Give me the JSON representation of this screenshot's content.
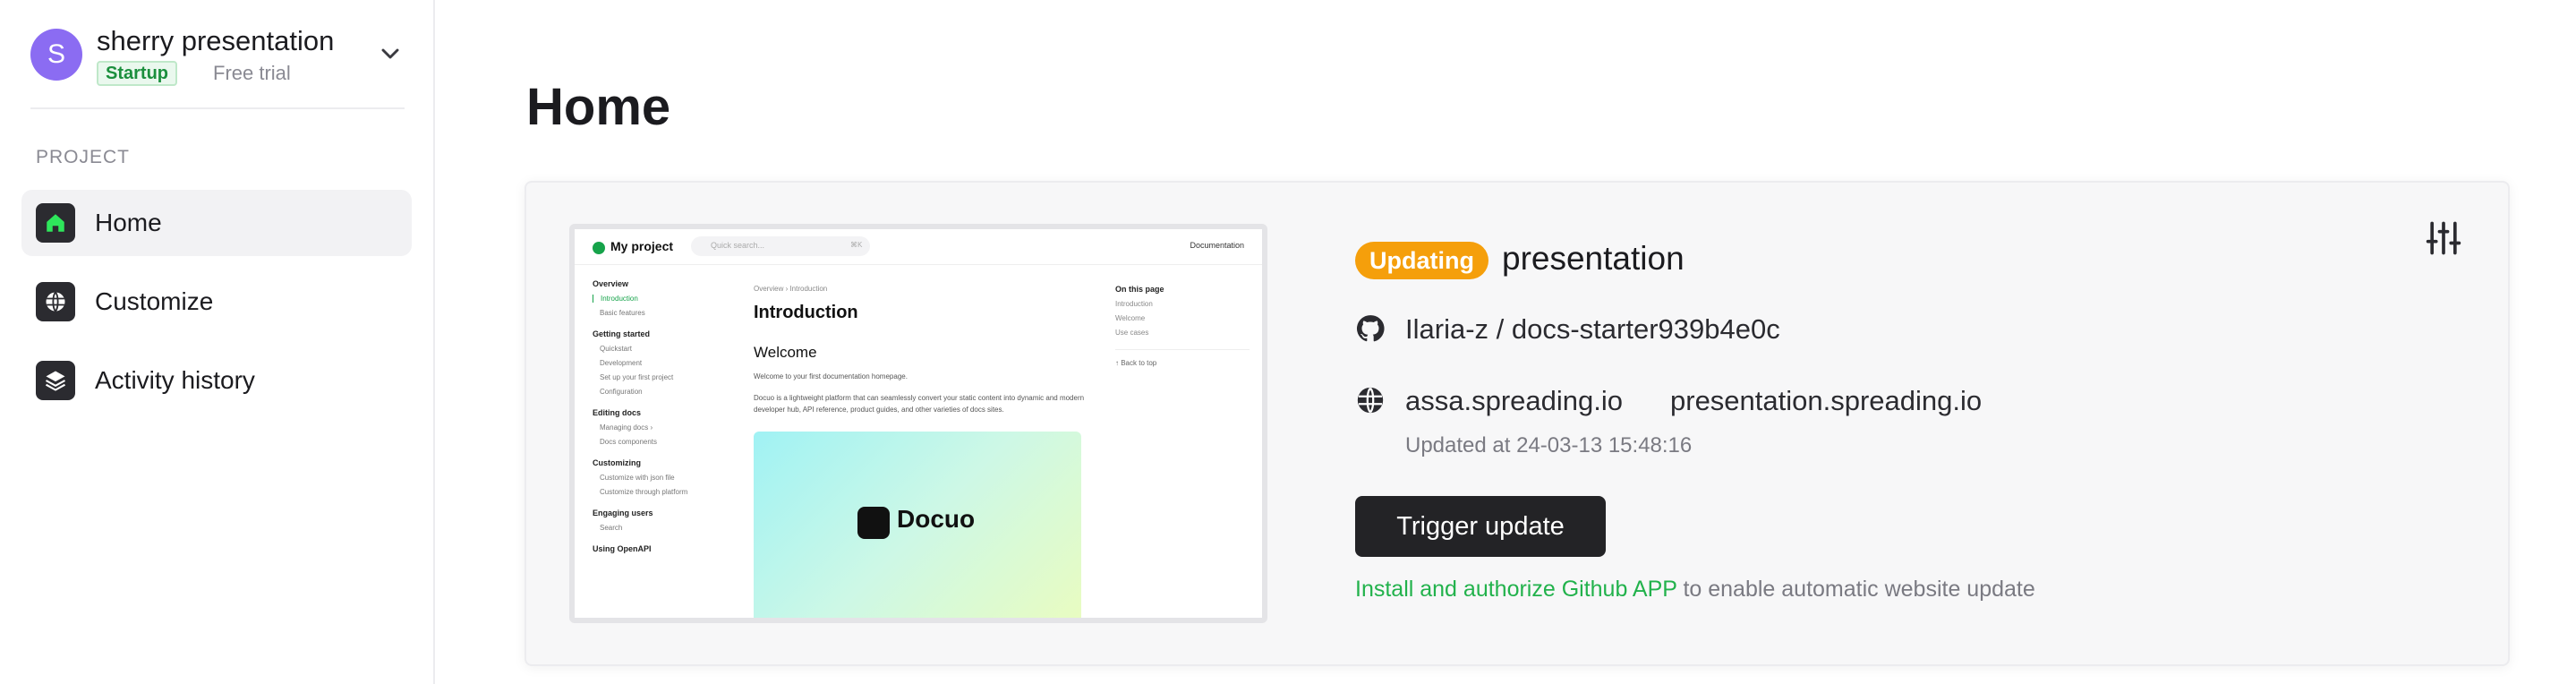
{
  "workspace": {
    "avatar_initial": "S",
    "name": "sherry presentation",
    "plan_badge": "Startup",
    "trial_label": "Free trial"
  },
  "sidebar": {
    "section_label": "PROJECT",
    "items": [
      {
        "label": "Home",
        "icon": "home-icon",
        "active": true
      },
      {
        "label": "Customize",
        "icon": "globe-icon",
        "active": false
      },
      {
        "label": "Activity history",
        "icon": "layers-icon",
        "active": false
      }
    ]
  },
  "main": {
    "title": "Home"
  },
  "site": {
    "status": "Updating",
    "name": "presentation",
    "repo": "Ilaria-z / docs-starter939b4e0c",
    "domain_primary": "assa.spreading.io",
    "domain_secondary": "presentation.spreading.io",
    "updated": "Updated at 24-03-13 15:48:16",
    "trigger_label": "Trigger update",
    "install_link": "Install and authorize Github APP",
    "install_rest": " to enable automatic website update"
  },
  "preview": {
    "project": "My project",
    "search_placeholder": "Quick search...",
    "search_kbd": "⌘K",
    "top_link": "Documentation",
    "breadcrumb": "Overview  ›  Introduction",
    "heading": "Introduction",
    "subheading": "Welcome",
    "intro": "Welcome to your first documentation homepage.",
    "body": "Docuo is a lightweight platform that can seamlessly convert your static content into dynamic and modern developer hub, API reference, product guides, and other varieties of docs sites.",
    "hero_brand": "Docuo",
    "nav": [
      {
        "group": "Overview",
        "links": [
          "Introduction",
          "Basic features"
        ]
      },
      {
        "group": "Getting started",
        "links": [
          "Quickstart",
          "Development",
          "Set up your first project",
          "Configuration"
        ]
      },
      {
        "group": "Editing docs",
        "links": [
          "Managing docs  ›",
          "Docs components"
        ]
      },
      {
        "group": "Customizing",
        "links": [
          "Customize with json file",
          "Customize through platform"
        ]
      },
      {
        "group": "Engaging users",
        "links": [
          "Search"
        ]
      },
      {
        "group": "Using OpenAPI",
        "links": []
      }
    ],
    "toc_title": "On this page",
    "toc_items": [
      "Introduction",
      "Welcome",
      "Use cases"
    ],
    "back_to_top": "↑  Back to top"
  },
  "colors": {
    "accent_green": "#22b24c",
    "status_orange": "#f59f0b",
    "avatar_purple": "#8b6cf2",
    "button_dark": "#232326"
  }
}
